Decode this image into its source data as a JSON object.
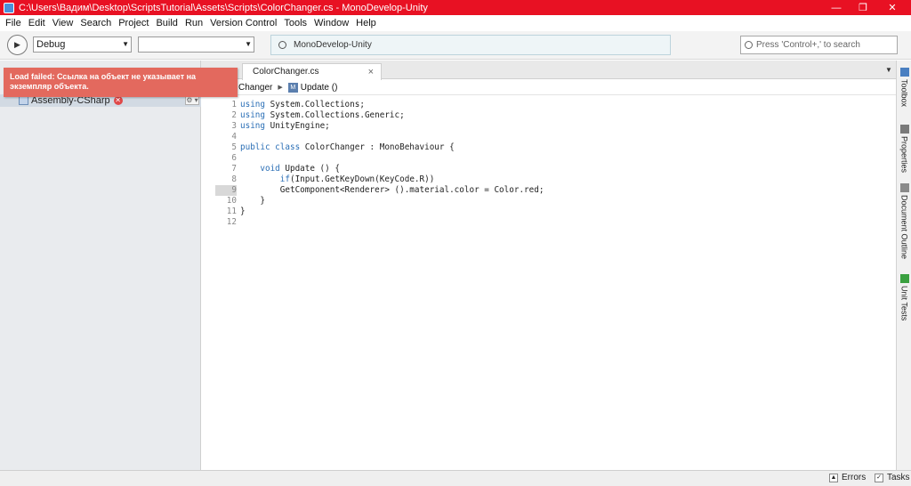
{
  "window": {
    "title": "C:\\Users\\Вадим\\Desktop\\ScriptsTutorial\\Assets\\Scripts\\ColorChanger.cs - MonoDevelop-Unity",
    "minimize_glyph": "—",
    "restore_glyph": "❐",
    "close_glyph": "✕"
  },
  "menu": [
    "File",
    "Edit",
    "View",
    "Search",
    "Project",
    "Build",
    "Run",
    "Version Control",
    "Tools",
    "Window",
    "Help"
  ],
  "toolbar": {
    "run_glyph": "▶",
    "config_value": "Debug",
    "target_value": "",
    "combo_arrow": "▼",
    "status_text": "MonoDevelop-Unity",
    "search_placeholder": "Press 'Control+,' to search"
  },
  "notification": {
    "text": "Load failed: Ссылка на объект не указывает на экземпляр объекта."
  },
  "solution": {
    "project_label": "Assembly-CSharp",
    "error_glyph": "✕",
    "gear_glyph": "⚙ ▾"
  },
  "tabs": [
    {
      "label": "ColorChanger.cs",
      "close_glyph": "×"
    }
  ],
  "tab_dropdown_glyph": "▼",
  "breadcrumb": {
    "class_label": "Changer",
    "separator": "▶",
    "method_icon": "M",
    "method_label": "Update ()"
  },
  "editor": {
    "lines": [
      {
        "num": "1",
        "kw": "using",
        "text": " System.Collections;"
      },
      {
        "num": "2",
        "kw": "using",
        "text": " System.Collections.Generic;"
      },
      {
        "num": "3",
        "kw": "using",
        "text": " UnityEngine;"
      },
      {
        "num": "4",
        "kw": "",
        "text": ""
      },
      {
        "num": "5",
        "kw": "public class",
        "text": " ColorChanger : MonoBehaviour {"
      },
      {
        "num": "6",
        "kw": "",
        "text": ""
      },
      {
        "num": "7",
        "kw": "    void",
        "text": " Update () {"
      },
      {
        "num": "8",
        "kw": "        if",
        "text": "(Input.GetKeyDown(KeyCode.R))"
      },
      {
        "num": "9",
        "kw": "",
        "text": "        GetComponent<Renderer> ().material.color = Color.red;"
      },
      {
        "num": "10",
        "kw": "",
        "text": "    }"
      },
      {
        "num": "11",
        "kw": "",
        "text": "}"
      },
      {
        "num": "12",
        "kw": "",
        "text": ""
      }
    ],
    "active_line": "9"
  },
  "side_pads": [
    {
      "label": "Toolbox",
      "icon_color": "#4a7fc1"
    },
    {
      "label": "Properties",
      "icon_color": "#7a7a7a"
    },
    {
      "label": "Document Outline",
      "icon_color": "#8a8a8a"
    },
    {
      "label": "Unit Tests",
      "icon_color": "#3aa040"
    }
  ],
  "statusbar": {
    "errors_label": "Errors",
    "tasks_label": "Tasks",
    "errors_glyph": "▲",
    "tasks_glyph": "✓"
  }
}
